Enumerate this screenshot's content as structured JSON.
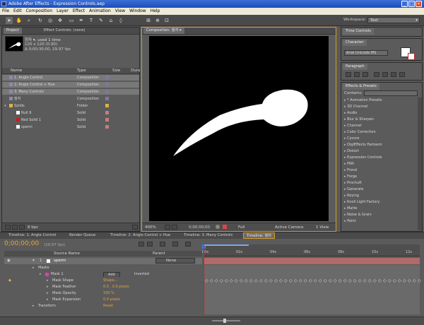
{
  "window": {
    "title": "Adobe After Effects - Expression Controls.aep"
  },
  "menu": [
    "File",
    "Edit",
    "Composition",
    "Layer",
    "Effect",
    "Animation",
    "View",
    "Window",
    "Help"
  ],
  "workspace": {
    "label": "Workspace:",
    "value": "Text"
  },
  "project": {
    "tab_project": "Project",
    "tab_effects": "Effect Controls: (none)",
    "info_name": "정자 ▾, used 1 time",
    "info_size": "120 x 120 (0.90)",
    "info_duration": "Δ 0;00;30;00, 29.97 fps",
    "columns": [
      "Name",
      "Type",
      "Size",
      "Dura"
    ],
    "items": [
      {
        "name": "1. Angle Control",
        "type": "Composition",
        "kind": "comp",
        "indent": 0
      },
      {
        "name": "2. Angle Control + Hue",
        "type": "Composition",
        "kind": "comp",
        "indent": 0
      },
      {
        "name": "3. Many Controls",
        "type": "Composition",
        "kind": "comp",
        "indent": 0
      },
      {
        "name": "정자",
        "type": "Composition",
        "kind": "comp",
        "indent": 0
      },
      {
        "name": "Solids",
        "type": "Folder",
        "kind": "folder",
        "indent": 0
      },
      {
        "name": "Null 9",
        "type": "Solid",
        "kind": "white",
        "indent": 1
      },
      {
        "name": "Red Solid 1",
        "type": "Solid",
        "kind": "red",
        "indent": 1
      },
      {
        "name": "sperm",
        "type": "Solid",
        "kind": "white",
        "indent": 1
      }
    ],
    "bpc": "8 bpc"
  },
  "composition": {
    "tab": "Composition: 정자 ▾",
    "zoom": "400%",
    "timecode": "0;00;00;00",
    "resolution": "Full",
    "camera": "Active Camera",
    "view": "1 View"
  },
  "right": {
    "time_controls": "Time Controls",
    "character": "Character",
    "font": "Arial Unicode MS",
    "paragraph": "Paragraph",
    "effects": "Effects & Presets",
    "contains": "Contains:",
    "effect_list": [
      "* Animation Presets",
      "3D Channel",
      "Audio",
      "Blur & Sharpen",
      "Channel",
      "Color Correction",
      "Cycore",
      "DigiEffects Fantasm",
      "Distort",
      "Expression Controls",
      "FAN",
      "Frond",
      "Forge",
      "Prochuft",
      "Generate",
      "Keying",
      "Knoll Light Factory",
      "Matte",
      "Noise & Grain",
      "Paint"
    ]
  },
  "timeline": {
    "tabs": [
      "Timeline: 1. Angle Control",
      "Render Queue",
      "Timeline: 2. Angle Control + Hue",
      "Timeline: 3. Many Controls",
      "Timeline: 정자"
    ],
    "timecode": "0;00;00;00",
    "fps": "(29.97 fps)",
    "col_source": "Source Name",
    "col_parent": "Parent",
    "ruler": [
      "00s",
      "02s",
      "04s",
      "06s",
      "08s",
      "10s",
      "12s"
    ],
    "layer": {
      "num": "1",
      "name": "sperm",
      "parent": "None"
    },
    "props": [
      {
        "label": "Masks",
        "value": "",
        "indent": 0
      },
      {
        "label": "Mask 1",
        "value": "Add",
        "extra": "Inverted",
        "indent": 1
      },
      {
        "label": "Mask Shape",
        "value": "Shape...",
        "indent": 2
      },
      {
        "label": "Mask Feather",
        "value": "0.0 , 0.0 pixels",
        "indent": 2
      },
      {
        "label": "Mask Opacity",
        "value": "100 %",
        "indent": 2
      },
      {
        "label": "Mask Expansion",
        "value": "0.0 pixels",
        "indent": 2
      },
      {
        "label": "Transform",
        "value": "Reset",
        "indent": 0
      }
    ]
  },
  "colors": {
    "accent": "#e8a33a",
    "red": "#cc1a1a",
    "bar": "#b06a6a",
    "playhead": "#cc2222"
  }
}
